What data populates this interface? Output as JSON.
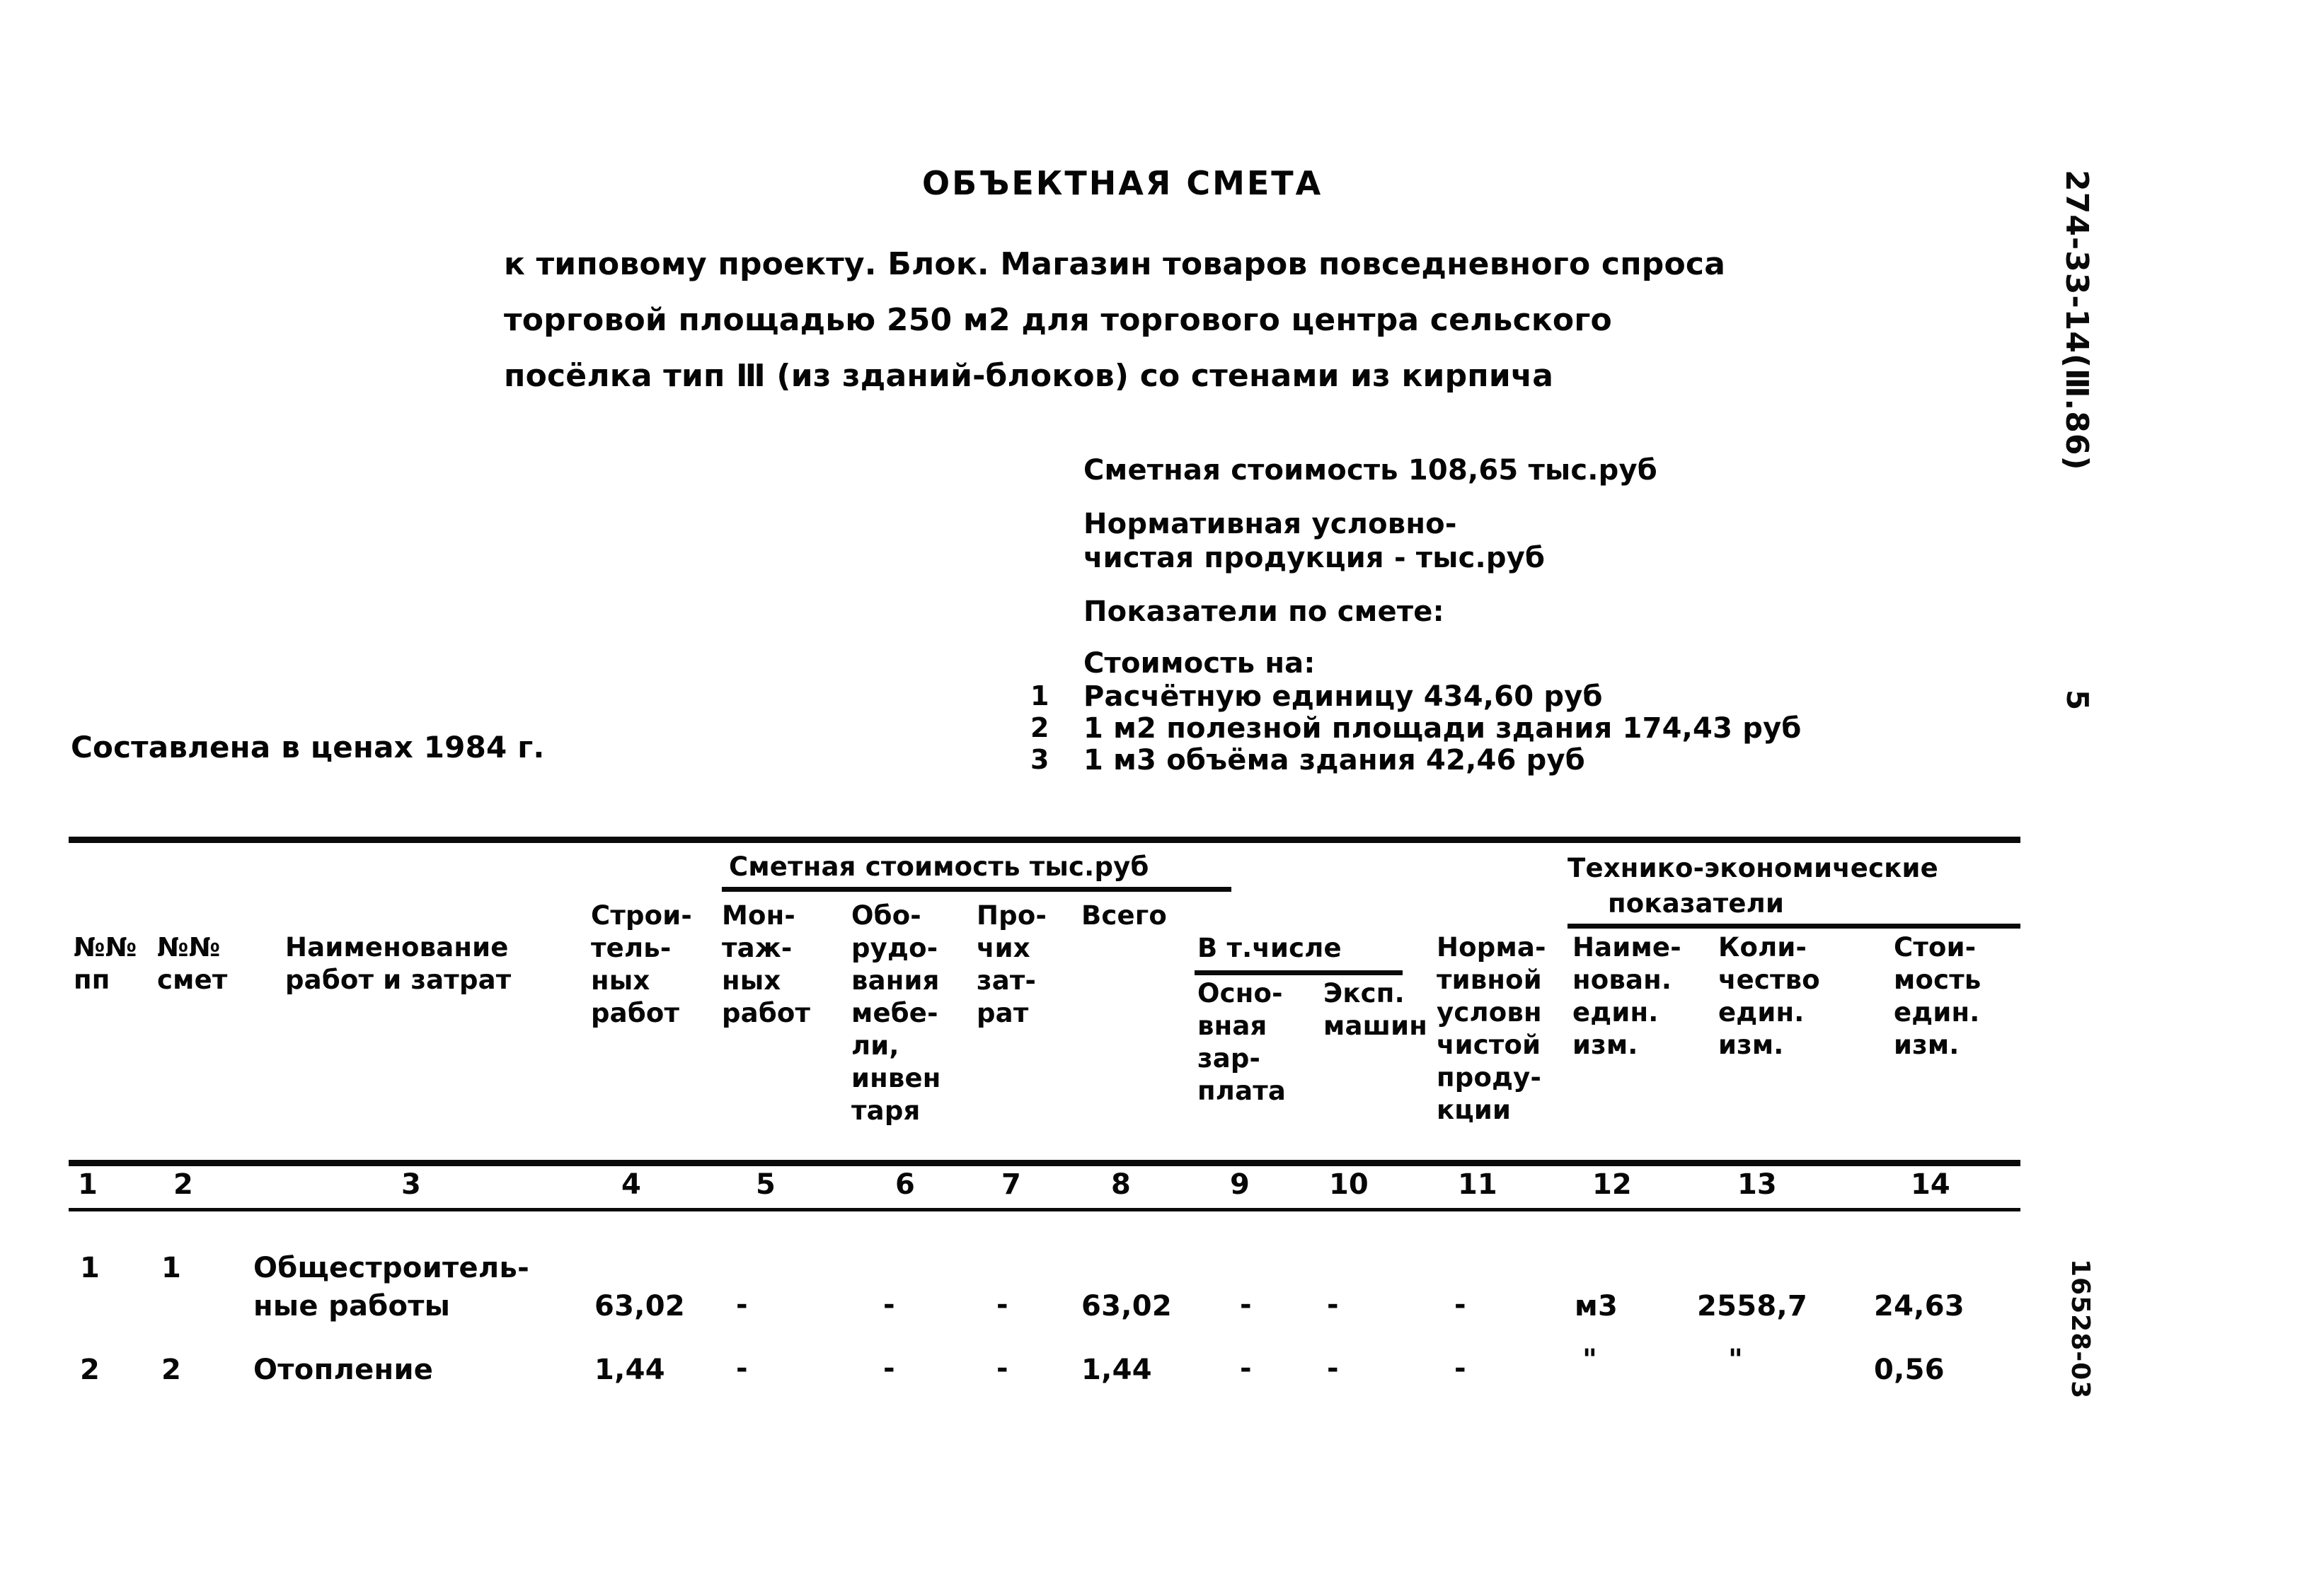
{
  "header": {
    "title": "ОБЪЕКТНАЯ СМЕТА",
    "subtitle_lines": [
      "к типовому проекту. Блок. Магазин товаров повседневного спроса",
      "торговой площадью 250 м2 для торгового центра сельского",
      "посёлка тип Ⅲ (из зданий-блоков) со стенами из кирпича"
    ]
  },
  "summary": {
    "estimate_cost": "Сметная стоимость 108,65 тыс.руб",
    "npp_line1": "Нормативная условно-",
    "npp_line2": "чистая продукция - тыс.руб",
    "indicators_label": "Показатели по смете:",
    "cost_per_label": "Стоимость на:",
    "indicators": [
      {
        "num": "1",
        "text": "Расчётную единицу 434,60 руб"
      },
      {
        "num": "2",
        "text": "1 м2 полезной площади здания 174,43 руб"
      },
      {
        "num": "3",
        "text": "1 м3 объёма здания 42,46 руб"
      }
    ],
    "prices_note": "Составлена в ценах 1984 г."
  },
  "table": {
    "group_headers": {
      "estimate_cost": "Сметная стоимость тыс.руб",
      "among_which": "В т.числе",
      "tech_econ_line1": "Технико-экономические",
      "tech_econ_line2": "показатели"
    },
    "columns": [
      {
        "num": "1",
        "header": "№№\nпп"
      },
      {
        "num": "2",
        "header": "№№\nсмет"
      },
      {
        "num": "3",
        "header": "Наименование\nработ и затрат"
      },
      {
        "num": "4",
        "header": "Строи-\nтель-\nных\nработ"
      },
      {
        "num": "5",
        "header": "Мон-\nтаж-\nных\nработ"
      },
      {
        "num": "6",
        "header": "Обо-\nрудо-\nвания\nмебе-\nли,\nинвен\nтаря"
      },
      {
        "num": "7",
        "header": "Про-\nчих\nзат-\nрат"
      },
      {
        "num": "8",
        "header": "Всего"
      },
      {
        "num": "9",
        "header": "Осно-\nвная\nзар-\nплата"
      },
      {
        "num": "10",
        "header": "Эксп.\nмашин"
      },
      {
        "num": "11",
        "header": "Норма-\nтивной\nусловн\nчистой\nproду-\nкции"
      },
      {
        "num": "12",
        "header": "Наиме-\nнован.\nедин.\nизм."
      },
      {
        "num": "13",
        "header": "Коли-\nчество\nедин.\nизм."
      },
      {
        "num": "14",
        "header": "Стои-\nмость\nедин.\nизм."
      }
    ],
    "column_header_11": "Норма-\nтивной\nусловн\nчистой\nпроду-\nкции",
    "rows": [
      {
        "pp": "1",
        "smeta": "1",
        "name_line1": "Общестроитель-",
        "name_line2": "ные работы",
        "construction": "63,02",
        "installation": "-",
        "equipment": "-",
        "other": "-",
        "total": "63,02",
        "base_salary": "-",
        "machines": "-",
        "npp": "-",
        "unit_name": "м3",
        "unit_qty": "2558,7",
        "unit_cost": "24,63"
      },
      {
        "pp": "2",
        "smeta": "2",
        "name_line1": "Отопление",
        "name_line2": "",
        "construction": "1,44",
        "installation": "-",
        "equipment": "-",
        "other": "-",
        "total": "1,44",
        "base_salary": "-",
        "machines": "-",
        "npp": "-",
        "unit_name": "\"",
        "unit_qty": "\"",
        "unit_cost": "0,56"
      }
    ]
  },
  "margin": {
    "code": "274-33-14(Ⅲ.86)",
    "page_number": "5",
    "stamp": "16528-03"
  }
}
